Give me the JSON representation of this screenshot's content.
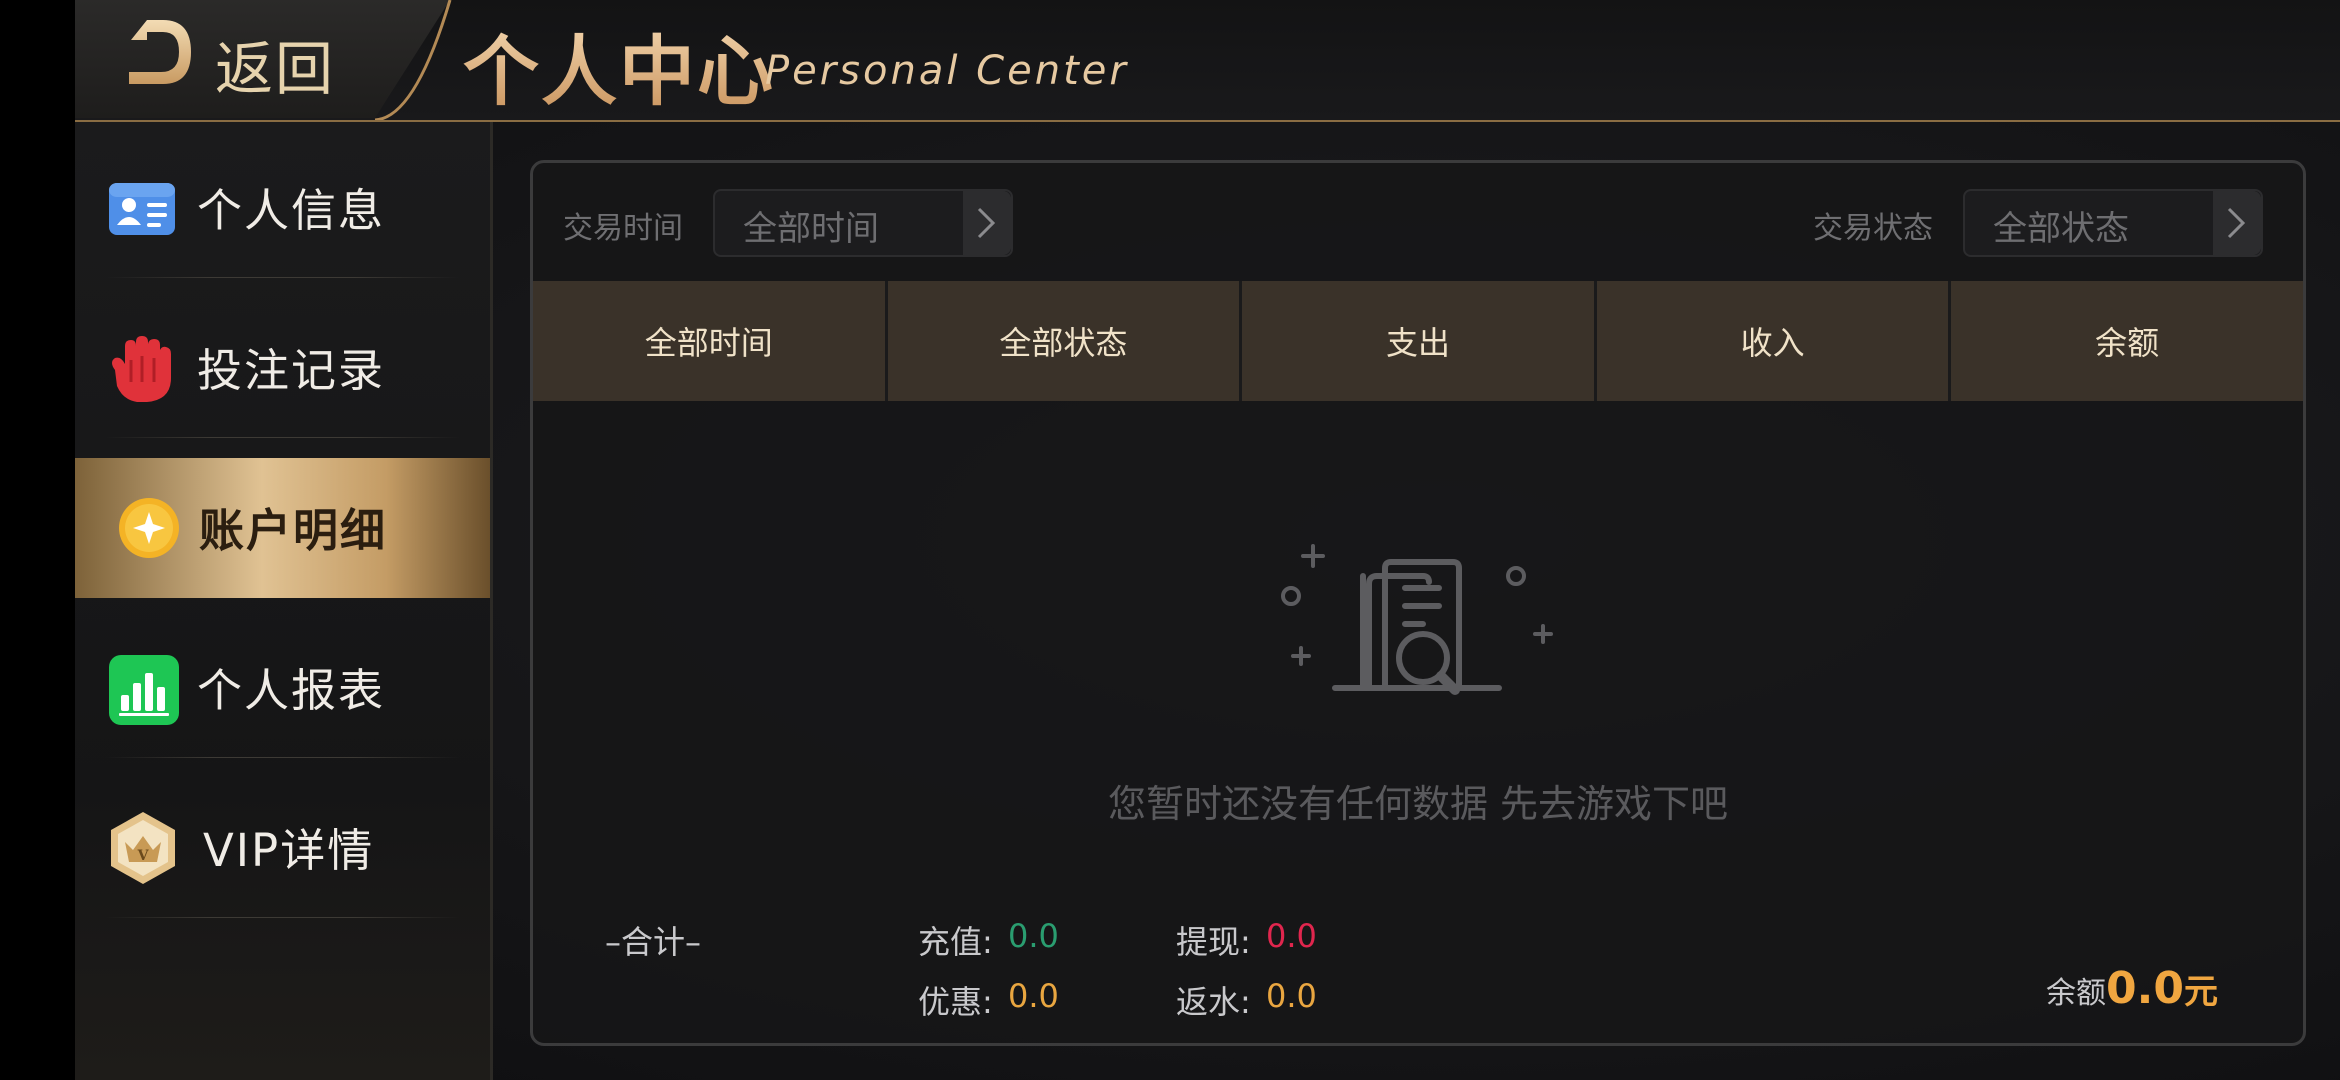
{
  "header": {
    "back_label": "返回",
    "title": "个人中心",
    "subtitle": "Personal Center"
  },
  "sidebar": {
    "items": [
      {
        "label": "个人信息",
        "icon": "id-card-icon",
        "active": false
      },
      {
        "label": "投注记录",
        "icon": "hand-icon",
        "active": false
      },
      {
        "label": "账户明细",
        "icon": "coin-icon",
        "active": true
      },
      {
        "label": "个人报表",
        "icon": "bar-chart-icon",
        "active": false
      },
      {
        "label": "VIP详情",
        "icon": "vip-crown-icon",
        "active": false
      }
    ]
  },
  "filters": {
    "time_label": "交易时间",
    "time_value": "全部时间",
    "status_label": "交易状态",
    "status_value": "全部状态"
  },
  "table": {
    "columns": [
      "全部时间",
      "全部状态",
      "支出",
      "收入",
      "余额"
    ],
    "rows": []
  },
  "empty_state": {
    "icon": "empty-document-search-icon",
    "message": "您暂时还没有任何数据 先去游戏下吧"
  },
  "summary": {
    "title": "–合计–",
    "recharge_label": "充值:",
    "recharge_value": "0.0",
    "withdraw_label": "提现:",
    "withdraw_value": "0.0",
    "discount_label": "优惠:",
    "discount_value": "0.0",
    "rebate_label": "返水:",
    "rebate_value": "0.0",
    "balance_label": "余额",
    "balance_value": "0.0",
    "balance_unit": "元"
  },
  "colors": {
    "accent_gold": "#e2b885",
    "recharge_green": "#2a9d70",
    "withdraw_red": "#e0264e",
    "value_orange": "#e9a640",
    "balance_orange": "#f0a640"
  }
}
